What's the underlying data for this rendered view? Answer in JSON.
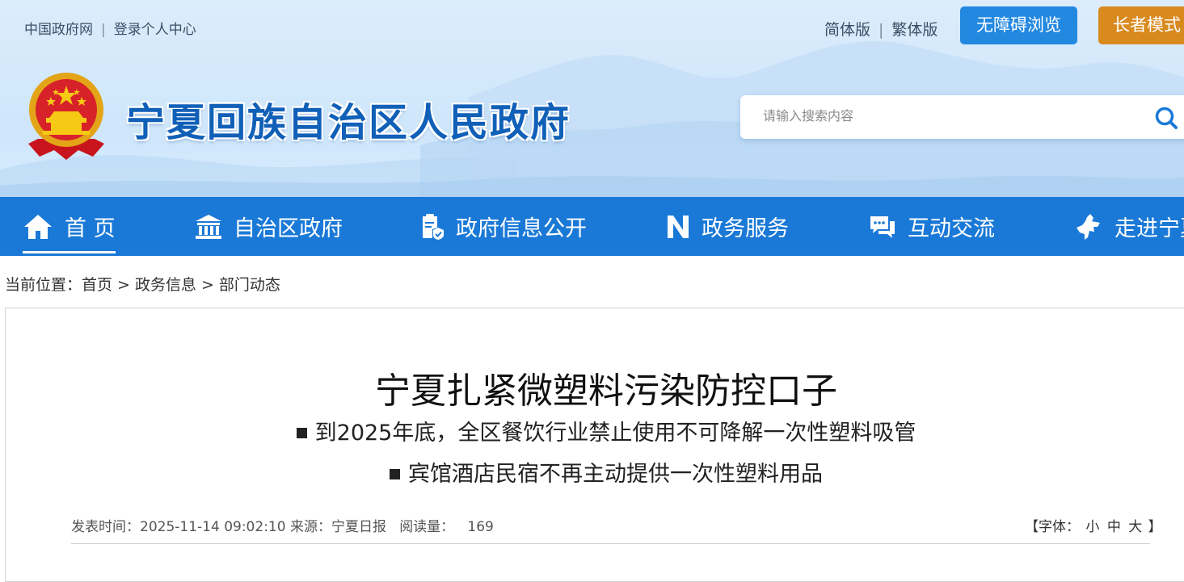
{
  "top_links": {
    "gov_portal": "中国政府网",
    "separator": "|",
    "login": "登录个人中心"
  },
  "version_links": {
    "simplified": "简体版",
    "separator": "|",
    "traditional": "繁体版"
  },
  "buttons": {
    "accessible": "无障碍浏览",
    "elder_mode": "长者模式"
  },
  "site_title": "宁夏回族自治区人民政府",
  "search": {
    "placeholder": "请输入搜索内容",
    "icon": "search-icon"
  },
  "nav": [
    {
      "label": "首 页",
      "icon": "home-icon"
    },
    {
      "label": "自治区政府",
      "icon": "government-building-icon"
    },
    {
      "label": "政府信息公开",
      "icon": "document-shield-icon"
    },
    {
      "label": "政务服务",
      "icon": "n-logo-icon"
    },
    {
      "label": "互动交流",
      "icon": "chat-bubbles-icon"
    },
    {
      "label": "走进宁夏",
      "icon": "ningxia-map-icon"
    }
  ],
  "breadcrumb": {
    "prefix": "当前位置：",
    "items": [
      "首页",
      "政务信息",
      "部门动态"
    ],
    "separator": ">"
  },
  "article": {
    "title": "宁夏扎紧微塑料污染防控口子",
    "subtitles": [
      "到2025年底，全区餐饮行业禁止使用不可降解一次性塑料吸管",
      "宾馆酒店民宿不再主动提供一次性塑料用品"
    ],
    "meta": {
      "time_label": "发表时间：",
      "time": "2025-11-14 09:02:10",
      "source_label": "来源：",
      "source": "宁夏日报",
      "reads_label": "阅读量：",
      "reads": "169"
    },
    "font_size": {
      "open": "【字体：",
      "small": "小",
      "medium": "中",
      "large": "大",
      "close": "】"
    }
  },
  "colors": {
    "nav_bg": "#1a79d7",
    "accessible_btn": "#2388e0",
    "elder_btn": "#d98a1f",
    "title_blue": "#1160b8"
  }
}
